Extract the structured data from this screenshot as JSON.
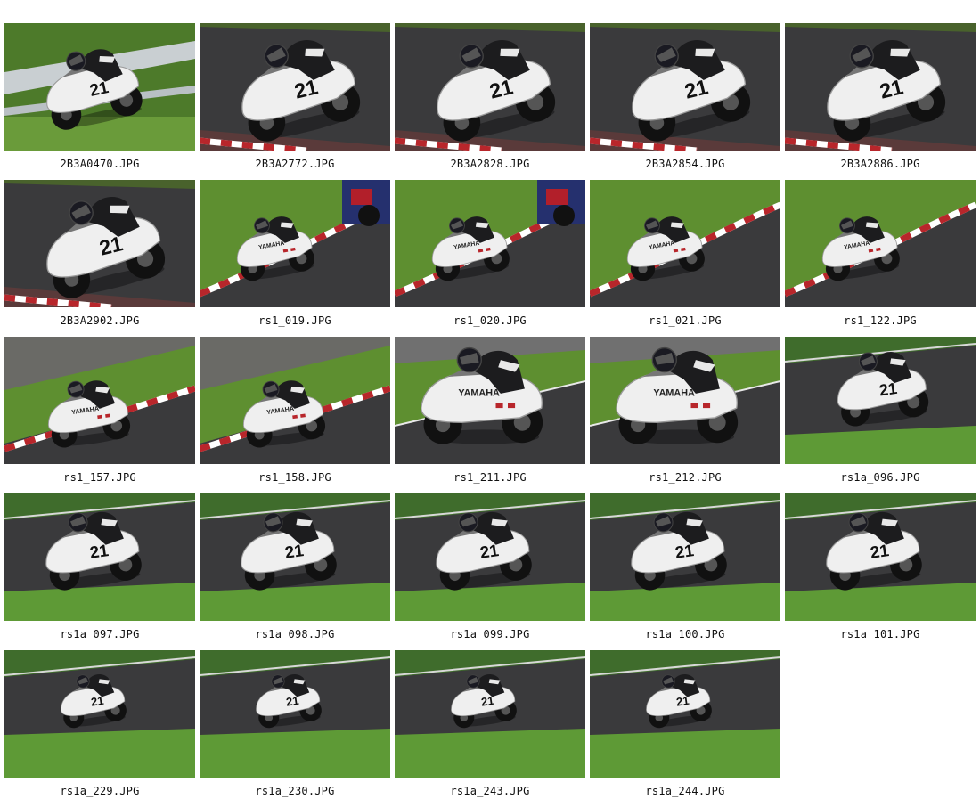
{
  "gallery": {
    "items": [
      {
        "file": "2B3A0470.JPG",
        "scene": "green-rail"
      },
      {
        "file": "2B3A2772.JPG",
        "scene": "dark-closeup"
      },
      {
        "file": "2B3A2828.JPG",
        "scene": "dark-closeup"
      },
      {
        "file": "2B3A2854.JPG",
        "scene": "dark-closeup"
      },
      {
        "file": "2B3A2886.JPG",
        "scene": "dark-closeup"
      },
      {
        "file": "2B3A2902.JPG",
        "scene": "dark-closeup"
      },
      {
        "file": "rs1_019.JPG",
        "scene": "grass-kerb-rival"
      },
      {
        "file": "rs1_020.JPG",
        "scene": "grass-kerb-rival"
      },
      {
        "file": "rs1_021.JPG",
        "scene": "grass-kerb"
      },
      {
        "file": "rs1_122.JPG",
        "scene": "grass-kerb"
      },
      {
        "file": "rs1_157.JPG",
        "scene": "gravel-kerb"
      },
      {
        "file": "rs1_158.JPG",
        "scene": "gravel-kerb"
      },
      {
        "file": "rs1_211.JPG",
        "scene": "upright-yamaha"
      },
      {
        "file": "rs1_212.JPG",
        "scene": "upright-yamaha"
      },
      {
        "file": "rs1a_096.JPG",
        "scene": "track-grass"
      },
      {
        "file": "rs1a_097.JPG",
        "scene": "track-grass"
      },
      {
        "file": "rs1a_098.JPG",
        "scene": "track-grass"
      },
      {
        "file": "rs1a_099.JPG",
        "scene": "track-grass"
      },
      {
        "file": "rs1a_100.JPG",
        "scene": "track-grass"
      },
      {
        "file": "rs1a_101.JPG",
        "scene": "track-grass"
      },
      {
        "file": "rs1a_229.JPG",
        "scene": "track-grass-far"
      },
      {
        "file": "rs1a_230.JPG",
        "scene": "track-grass-far"
      },
      {
        "file": "rs1a_243.JPG",
        "scene": "track-grass-far"
      },
      {
        "file": "rs1a_244.JPG",
        "scene": "track-grass-far"
      }
    ],
    "bike_number": "21",
    "brand_text": "YAMAHA",
    "colors": {
      "asphalt": "#3a3a3c",
      "grass": "#5e8f30",
      "bike": "#efefef",
      "suit": "#1c1c1e",
      "kerb_red": "#b8262b"
    }
  }
}
